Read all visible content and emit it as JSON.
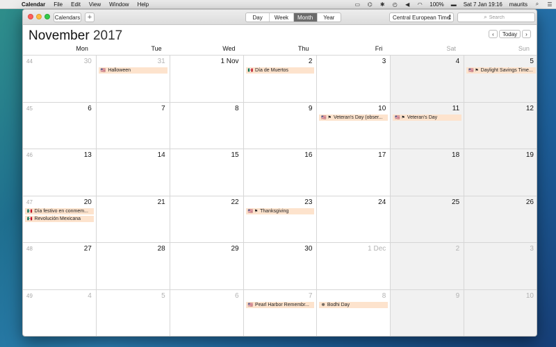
{
  "menubar": {
    "apple_icon": "apple-icon",
    "items": [
      "Calendar",
      "File",
      "Edit",
      "View",
      "Window",
      "Help"
    ],
    "status_icons": [
      "airplay-icon",
      "dropbox-icon",
      "bluetooth-icon",
      "time-machine-icon",
      "volume-icon",
      "wifi-icon"
    ],
    "battery": "100%",
    "datetime": "Sat 7 Jan  19:16",
    "user": "maurits"
  },
  "toolbar": {
    "calendars_label": "Calendars",
    "add_label": "+",
    "views": [
      {
        "label": "Day",
        "active": false
      },
      {
        "label": "Week",
        "active": false
      },
      {
        "label": "Month",
        "active": true
      },
      {
        "label": "Year",
        "active": false
      }
    ],
    "timezone": "Central European Time",
    "search_placeholder": "Search"
  },
  "header": {
    "month": "November",
    "year": "2017",
    "today_label": "Today"
  },
  "weekdays": [
    "Mon",
    "Tue",
    "Wed",
    "Thu",
    "Fri",
    "Sat",
    "Sun"
  ],
  "weeks": [
    {
      "number": "44",
      "days": [
        {
          "label": "30",
          "other": true,
          "events": []
        },
        {
          "label": "31",
          "other": true,
          "events": [
            {
              "icon": "🇺🇸",
              "title": "Halloween"
            }
          ]
        },
        {
          "label": "1 Nov",
          "other": false,
          "events": []
        },
        {
          "label": "2",
          "other": false,
          "events": [
            {
              "icon": "🇲🇽",
              "title": "Día de Muertos"
            }
          ]
        },
        {
          "label": "3",
          "other": false,
          "events": []
        },
        {
          "label": "4",
          "other": false,
          "events": []
        },
        {
          "label": "5",
          "other": false,
          "events": [
            {
              "icon": "🇺🇸 ⚑",
              "title": "Daylight Savings Time..."
            }
          ]
        }
      ]
    },
    {
      "number": "45",
      "days": [
        {
          "label": "6",
          "other": false,
          "events": []
        },
        {
          "label": "7",
          "other": false,
          "events": []
        },
        {
          "label": "8",
          "other": false,
          "events": []
        },
        {
          "label": "9",
          "other": false,
          "events": []
        },
        {
          "label": "10",
          "other": false,
          "events": [
            {
              "icon": "🇺🇸 ⚑",
              "title": "Veteran's Day (obser..."
            }
          ]
        },
        {
          "label": "11",
          "other": false,
          "events": [
            {
              "icon": "🇺🇸 ⚑",
              "title": "Veteran's Day"
            }
          ]
        },
        {
          "label": "12",
          "other": false,
          "events": []
        }
      ]
    },
    {
      "number": "46",
      "days": [
        {
          "label": "13",
          "other": false,
          "events": []
        },
        {
          "label": "14",
          "other": false,
          "events": []
        },
        {
          "label": "15",
          "other": false,
          "events": []
        },
        {
          "label": "16",
          "other": false,
          "events": []
        },
        {
          "label": "17",
          "other": false,
          "events": []
        },
        {
          "label": "18",
          "other": false,
          "events": []
        },
        {
          "label": "19",
          "other": false,
          "events": []
        }
      ]
    },
    {
      "number": "47",
      "days": [
        {
          "label": "20",
          "other": false,
          "events": [
            {
              "icon": "🇲🇽",
              "title": "Día festivo en conmem..."
            },
            {
              "icon": "🇲🇽",
              "title": "Revolución Mexicana"
            }
          ]
        },
        {
          "label": "21",
          "other": false,
          "events": []
        },
        {
          "label": "22",
          "other": false,
          "events": []
        },
        {
          "label": "23",
          "other": false,
          "events": [
            {
              "icon": "🇺🇸 ⚑",
              "title": "Thanksgiving"
            }
          ]
        },
        {
          "label": "24",
          "other": false,
          "events": []
        },
        {
          "label": "25",
          "other": false,
          "events": []
        },
        {
          "label": "26",
          "other": false,
          "events": []
        }
      ]
    },
    {
      "number": "48",
      "days": [
        {
          "label": "27",
          "other": false,
          "events": []
        },
        {
          "label": "28",
          "other": false,
          "events": []
        },
        {
          "label": "29",
          "other": false,
          "events": []
        },
        {
          "label": "30",
          "other": false,
          "events": []
        },
        {
          "label": "1 Dec",
          "other": true,
          "events": []
        },
        {
          "label": "2",
          "other": true,
          "events": []
        },
        {
          "label": "3",
          "other": true,
          "events": []
        }
      ]
    },
    {
      "number": "49",
      "days": [
        {
          "label": "4",
          "other": true,
          "events": []
        },
        {
          "label": "5",
          "other": true,
          "events": []
        },
        {
          "label": "6",
          "other": true,
          "events": []
        },
        {
          "label": "7",
          "other": true,
          "events": [
            {
              "icon": "🇺🇸",
              "title": "Pearl Harbor Remembr..."
            }
          ]
        },
        {
          "label": "8",
          "other": true,
          "events": [
            {
              "icon": "☸",
              "title": "Bodhi Day"
            }
          ]
        },
        {
          "label": "9",
          "other": true,
          "events": []
        },
        {
          "label": "10",
          "other": true,
          "events": []
        }
      ]
    }
  ],
  "colors": {
    "event_bg": "#fde3cd",
    "weekend_bg": "#f1f1f1",
    "active_segment": "#6b6b6b"
  }
}
